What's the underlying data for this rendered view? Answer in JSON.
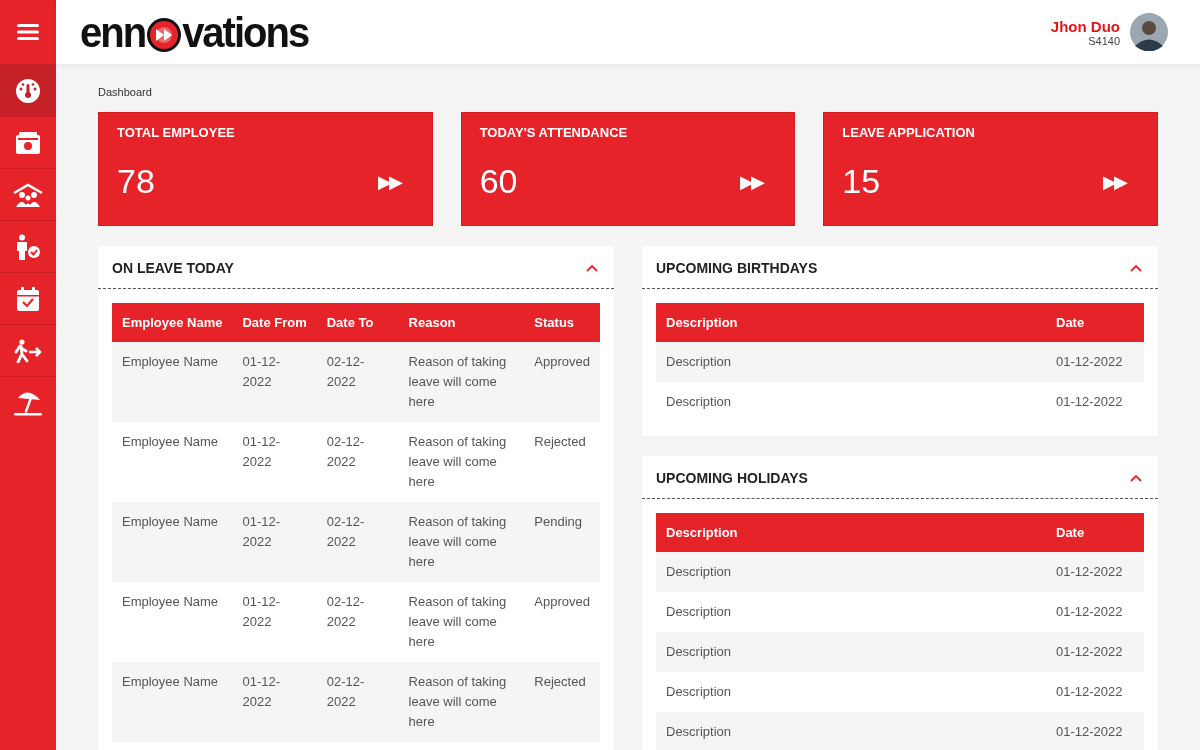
{
  "logo": {
    "text_before": "enn",
    "text_after": "vations"
  },
  "user": {
    "name": "Jhon Duo",
    "id": "S4140"
  },
  "sidebar": {
    "items": [
      {
        "selected": true
      },
      {
        "selected": false
      },
      {
        "selected": false
      },
      {
        "selected": false
      },
      {
        "selected": false
      },
      {
        "selected": false
      },
      {
        "selected": false
      }
    ]
  },
  "breadcrumb": "Dashboard",
  "stats": [
    {
      "label": "TOTAL EMPLOYEE",
      "value": "78",
      "action": "▶▶"
    },
    {
      "label": "TODAY'S ATTENDANCE",
      "value": "60",
      "action": "▶▶"
    },
    {
      "label": "LEAVE APPLICATION",
      "value": "15",
      "action": "▶▶"
    }
  ],
  "on_leave": {
    "title": "ON LEAVE TODAY",
    "expanded": true,
    "columns": [
      "Employee Name",
      "Date From",
      "Date To",
      "Reason",
      "Status"
    ],
    "rows": [
      [
        "Employee Name",
        "01-12-2022",
        "02-12-2022",
        "Reason of taking leave will come here",
        "Approved"
      ],
      [
        "Employee Name",
        "01-12-2022",
        "02-12-2022",
        "Reason of taking leave will come here",
        "Rejected"
      ],
      [
        "Employee Name",
        "01-12-2022",
        "02-12-2022",
        "Reason of taking leave will come here",
        "Pending"
      ],
      [
        "Employee Name",
        "01-12-2022",
        "02-12-2022",
        "Reason of taking leave will come here",
        "Approved"
      ],
      [
        "Employee Name",
        "01-12-2022",
        "02-12-2022",
        "Reason of taking leave will come here",
        "Rejected"
      ]
    ]
  },
  "birthdays": {
    "title": "UPCOMING BIRTHDAYS",
    "expanded": true,
    "columns": [
      "Description",
      "Date"
    ],
    "rows": [
      [
        "Description",
        "01-12-2022"
      ],
      [
        "Description",
        "01-12-2022"
      ]
    ]
  },
  "holidays": {
    "title": "UPCOMING HOLIDAYS",
    "expanded": true,
    "columns": [
      "Description",
      "Date"
    ],
    "rows": [
      [
        "Description",
        "01-12-2022"
      ],
      [
        "Description",
        "01-12-2022"
      ],
      [
        "Description",
        "01-12-2022"
      ],
      [
        "Description",
        "01-12-2022"
      ],
      [
        "Description",
        "01-12-2022"
      ]
    ]
  }
}
